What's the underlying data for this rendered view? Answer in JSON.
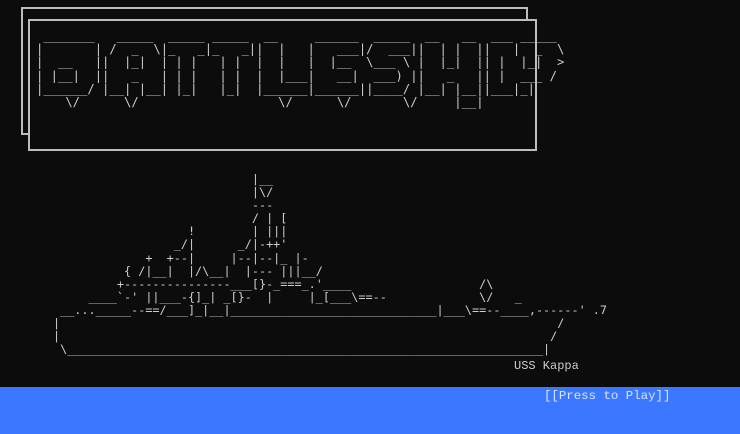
{
  "title_art": " _______   _____  _____ _____  __     ______  _____  __   __  ___ _____\n|       | /  _  \\|_   _|_   _||  |   |   ___|/  ___||  | |  ||   |  _  \\\n|  __   ||  |_|  | | |   | |  |  |   |  |__  \\___ \\ |  |_|  || |  |_|  >\n| |__|  ||   _   | | |   | |  |  |___|   __|  ___) ||   _   || |  ___ /\n|______/ |__| |__| |_|   |_|  |______|______||____/ |__| |__||___|_|\n    \\/      \\/                   \\/      \\/       \\/     |__|",
  "ship_art": "                            |__\n                            |\\/\n                            ---\n                            / | [\n                   !        | |||\n                 _/|      _/|-++'\n             +  +--|     |--|--|_ |-\n          { /|__|  |/\\__|  |--- |||__/\n         +---------------___[}-_===_.'____                  /\\\n     ____`-' ||___-{]_| _[}-  |     |_[___\\==--             \\/   _\n __..._____--==/___]_|__|_____________________________|___\\==--____,------' .7\n|                                                                      /\n|                                                                     /\n \\___________________________________________________________________|",
  "ship_name": "USS Kappa",
  "press_to_play": "[[Press to Play]]",
  "colors": {
    "background": "#0c0c0c",
    "text": "#cccccc",
    "water": "#3b78ff",
    "prompt_text": "#dbe6ff"
  }
}
